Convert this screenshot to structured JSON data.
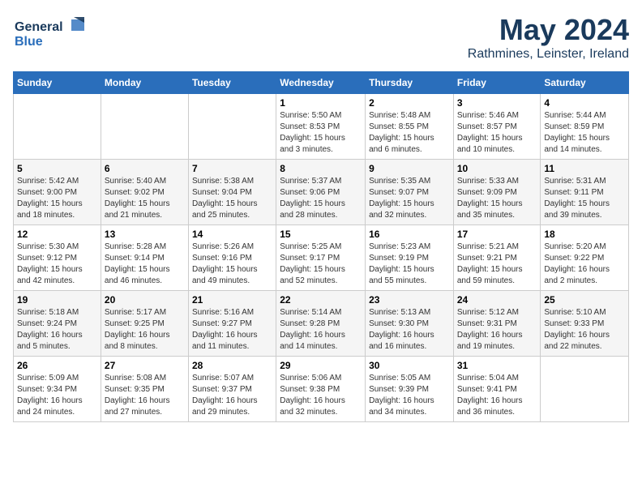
{
  "logo": {
    "line1": "General",
    "line2": "Blue"
  },
  "title": "May 2024",
  "subtitle": "Rathmines, Leinster, Ireland",
  "days_header": [
    "Sunday",
    "Monday",
    "Tuesday",
    "Wednesday",
    "Thursday",
    "Friday",
    "Saturday"
  ],
  "weeks": [
    [
      {
        "day": "",
        "info": ""
      },
      {
        "day": "",
        "info": ""
      },
      {
        "day": "",
        "info": ""
      },
      {
        "day": "1",
        "info": "Sunrise: 5:50 AM\nSunset: 8:53 PM\nDaylight: 15 hours\nand 3 minutes."
      },
      {
        "day": "2",
        "info": "Sunrise: 5:48 AM\nSunset: 8:55 PM\nDaylight: 15 hours\nand 6 minutes."
      },
      {
        "day": "3",
        "info": "Sunrise: 5:46 AM\nSunset: 8:57 PM\nDaylight: 15 hours\nand 10 minutes."
      },
      {
        "day": "4",
        "info": "Sunrise: 5:44 AM\nSunset: 8:59 PM\nDaylight: 15 hours\nand 14 minutes."
      }
    ],
    [
      {
        "day": "5",
        "info": "Sunrise: 5:42 AM\nSunset: 9:00 PM\nDaylight: 15 hours\nand 18 minutes."
      },
      {
        "day": "6",
        "info": "Sunrise: 5:40 AM\nSunset: 9:02 PM\nDaylight: 15 hours\nand 21 minutes."
      },
      {
        "day": "7",
        "info": "Sunrise: 5:38 AM\nSunset: 9:04 PM\nDaylight: 15 hours\nand 25 minutes."
      },
      {
        "day": "8",
        "info": "Sunrise: 5:37 AM\nSunset: 9:06 PM\nDaylight: 15 hours\nand 28 minutes."
      },
      {
        "day": "9",
        "info": "Sunrise: 5:35 AM\nSunset: 9:07 PM\nDaylight: 15 hours\nand 32 minutes."
      },
      {
        "day": "10",
        "info": "Sunrise: 5:33 AM\nSunset: 9:09 PM\nDaylight: 15 hours\nand 35 minutes."
      },
      {
        "day": "11",
        "info": "Sunrise: 5:31 AM\nSunset: 9:11 PM\nDaylight: 15 hours\nand 39 minutes."
      }
    ],
    [
      {
        "day": "12",
        "info": "Sunrise: 5:30 AM\nSunset: 9:12 PM\nDaylight: 15 hours\nand 42 minutes."
      },
      {
        "day": "13",
        "info": "Sunrise: 5:28 AM\nSunset: 9:14 PM\nDaylight: 15 hours\nand 46 minutes."
      },
      {
        "day": "14",
        "info": "Sunrise: 5:26 AM\nSunset: 9:16 PM\nDaylight: 15 hours\nand 49 minutes."
      },
      {
        "day": "15",
        "info": "Sunrise: 5:25 AM\nSunset: 9:17 PM\nDaylight: 15 hours\nand 52 minutes."
      },
      {
        "day": "16",
        "info": "Sunrise: 5:23 AM\nSunset: 9:19 PM\nDaylight: 15 hours\nand 55 minutes."
      },
      {
        "day": "17",
        "info": "Sunrise: 5:21 AM\nSunset: 9:21 PM\nDaylight: 15 hours\nand 59 minutes."
      },
      {
        "day": "18",
        "info": "Sunrise: 5:20 AM\nSunset: 9:22 PM\nDaylight: 16 hours\nand 2 minutes."
      }
    ],
    [
      {
        "day": "19",
        "info": "Sunrise: 5:18 AM\nSunset: 9:24 PM\nDaylight: 16 hours\nand 5 minutes."
      },
      {
        "day": "20",
        "info": "Sunrise: 5:17 AM\nSunset: 9:25 PM\nDaylight: 16 hours\nand 8 minutes."
      },
      {
        "day": "21",
        "info": "Sunrise: 5:16 AM\nSunset: 9:27 PM\nDaylight: 16 hours\nand 11 minutes."
      },
      {
        "day": "22",
        "info": "Sunrise: 5:14 AM\nSunset: 9:28 PM\nDaylight: 16 hours\nand 14 minutes."
      },
      {
        "day": "23",
        "info": "Sunrise: 5:13 AM\nSunset: 9:30 PM\nDaylight: 16 hours\nand 16 minutes."
      },
      {
        "day": "24",
        "info": "Sunrise: 5:12 AM\nSunset: 9:31 PM\nDaylight: 16 hours\nand 19 minutes."
      },
      {
        "day": "25",
        "info": "Sunrise: 5:10 AM\nSunset: 9:33 PM\nDaylight: 16 hours\nand 22 minutes."
      }
    ],
    [
      {
        "day": "26",
        "info": "Sunrise: 5:09 AM\nSunset: 9:34 PM\nDaylight: 16 hours\nand 24 minutes."
      },
      {
        "day": "27",
        "info": "Sunrise: 5:08 AM\nSunset: 9:35 PM\nDaylight: 16 hours\nand 27 minutes."
      },
      {
        "day": "28",
        "info": "Sunrise: 5:07 AM\nSunset: 9:37 PM\nDaylight: 16 hours\nand 29 minutes."
      },
      {
        "day": "29",
        "info": "Sunrise: 5:06 AM\nSunset: 9:38 PM\nDaylight: 16 hours\nand 32 minutes."
      },
      {
        "day": "30",
        "info": "Sunrise: 5:05 AM\nSunset: 9:39 PM\nDaylight: 16 hours\nand 34 minutes."
      },
      {
        "day": "31",
        "info": "Sunrise: 5:04 AM\nSunset: 9:41 PM\nDaylight: 16 hours\nand 36 minutes."
      },
      {
        "day": "",
        "info": ""
      }
    ]
  ]
}
